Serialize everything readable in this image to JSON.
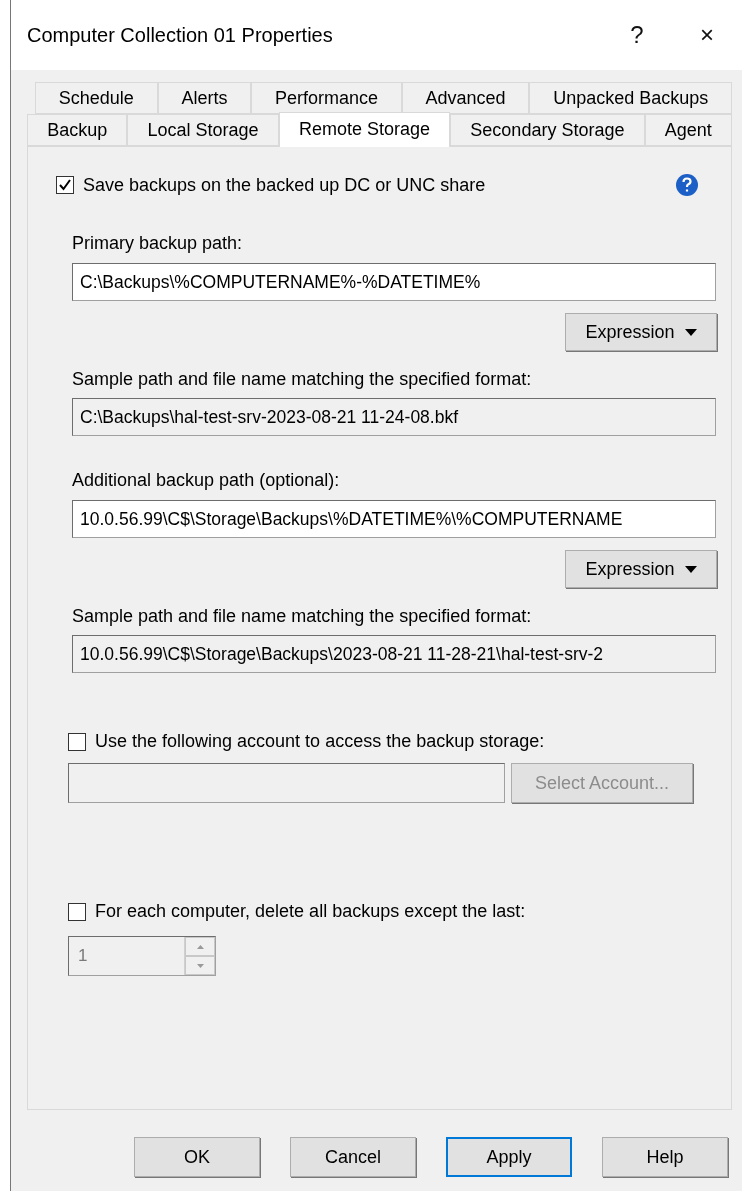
{
  "window": {
    "title": "Computer Collection 01 Properties",
    "help": "?",
    "close": "×"
  },
  "tab_rows": [
    [
      {
        "label": "Schedule",
        "selected": false
      },
      {
        "label": "Alerts",
        "selected": false
      },
      {
        "label": "Performance",
        "selected": false
      },
      {
        "label": "Advanced",
        "selected": false
      },
      {
        "label": "Unpacked Backups",
        "selected": false
      }
    ],
    [
      {
        "label": "Backup",
        "selected": false
      },
      {
        "label": "Local Storage",
        "selected": false
      },
      {
        "label": "Remote Storage",
        "selected": true
      },
      {
        "label": "Secondary Storage",
        "selected": false
      },
      {
        "label": "Agent",
        "selected": false
      }
    ]
  ],
  "save_backups": {
    "label": "Save backups on the backed up DC or UNC share",
    "checked": true
  },
  "primary": {
    "label": "Primary backup path:",
    "value": "C:\\Backups\\%COMPUTERNAME%-%DATETIME%",
    "button": "Expression",
    "sample_label": "Sample path and file name matching the specified format:",
    "sample": "C:\\Backups\\hal-test-srv-2023-08-21 11-24-08.bkf"
  },
  "additional": {
    "label": "Additional backup path (optional):",
    "value": "10.0.56.99\\C$\\Storage\\Backups\\%DATETIME%\\%COMPUTERNAME",
    "button": "Expression",
    "sample_label": "Sample path and file name matching the specified format:",
    "sample": "10.0.56.99\\C$\\Storage\\Backups\\2023-08-21 11-28-21\\hal-test-srv-2"
  },
  "account": {
    "label": "Use the following account to access the backup storage:",
    "checked": false,
    "disabled": true,
    "button": "Select Account..."
  },
  "delete_old": {
    "label": "For each computer, delete all backups except the last:",
    "checked": false,
    "disabled": true,
    "value": "1"
  },
  "buttons": [
    {
      "label": "OK",
      "default": false
    },
    {
      "label": "Cancel",
      "default": false
    },
    {
      "label": "Apply",
      "default": true
    },
    {
      "label": "Help",
      "default": false
    }
  ]
}
